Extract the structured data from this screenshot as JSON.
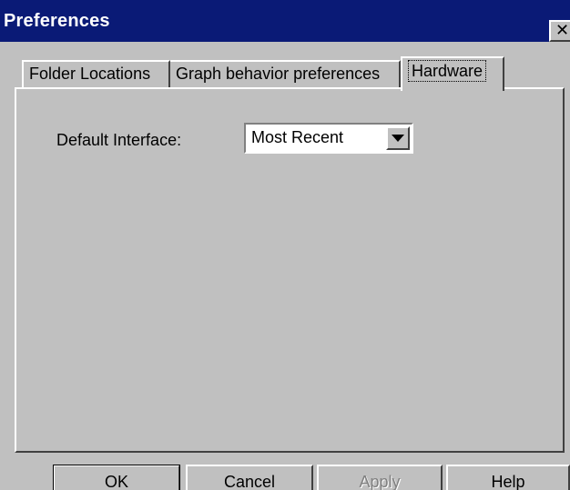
{
  "window": {
    "title": "Preferences",
    "close_glyph": "✕"
  },
  "tabs": [
    {
      "label": "Folder Locations",
      "selected": false
    },
    {
      "label": "Graph behavior preferences",
      "selected": false
    },
    {
      "label": "Hardware",
      "selected": true
    }
  ],
  "hardware_panel": {
    "default_interface_label": "Default Interface:",
    "default_interface_value": "Most Recent"
  },
  "buttons": {
    "ok": "OK",
    "cancel": "Cancel",
    "apply": "Apply",
    "help": "Help"
  },
  "colors": {
    "titlebar": "#0a1a76",
    "face": "#c0c0c0",
    "disabled_text": "#808080"
  }
}
